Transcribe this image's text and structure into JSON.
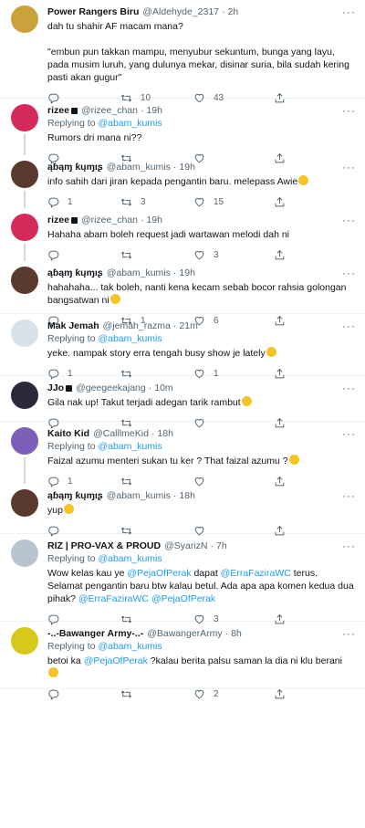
{
  "tweets": [
    {
      "name": "Power Rangers Biru",
      "handle": "@Aldehyde_2317",
      "time": "2h",
      "replying": "",
      "reply_to": "",
      "text": "dah tu shahir AF macam mana?\n\n\"embun pun takkan mampu, menyubur sekuntum, bunga yang layu, pada musim luruh, yang dulunya mekar, disinar suria, bila sudah kering pasti akan gugur\"",
      "replies": "",
      "retweets": "10",
      "likes": "43",
      "avatar_color": "#c9a23a"
    },
    {
      "name": "rizee",
      "handle": "@rizee_chan",
      "time": "19h",
      "replying": "Replying to",
      "reply_to": "@abam_kumis",
      "text": "Rumors dri mana ni??",
      "replies": "",
      "retweets": "",
      "likes": "",
      "avatar_color": "#d62b5a"
    },
    {
      "name": "ąɓąɱ ƙųɱıʂ",
      "handle": "@abam_kumis",
      "time": "19h",
      "replying": "",
      "reply_to": "",
      "text": "info sahih dari jiran kepada pengantin baru. melepass Awie",
      "replies": "1",
      "retweets": "3",
      "likes": "15",
      "avatar_color": "#5a3a2e"
    },
    {
      "name": "rizee",
      "handle": "@rizee_chan",
      "time": "19h",
      "replying": "",
      "reply_to": "",
      "text": "Hahaha abam boleh request jadi wartawan melodi dah ni",
      "replies": "",
      "retweets": "",
      "likes": "3",
      "avatar_color": "#d62b5a"
    },
    {
      "name": "ąɓąɱ ƙųɱıʂ",
      "handle": "@abam_kumis",
      "time": "19h",
      "replying": "",
      "reply_to": "",
      "text": "hahahaha... tak boleh, nanti kena kecam sebab bocor rahsia golongan bangsatwan ni",
      "replies": "",
      "retweets": "1",
      "likes": "6",
      "avatar_color": "#5a3a2e"
    },
    {
      "name": "Mak Jemah",
      "handle": "@jemah_razma",
      "time": "21m",
      "replying": "Replying to",
      "reply_to": "@abam_kumis",
      "text": "yeke. nampak story erra tengah busy show je lately",
      "replies": "1",
      "retweets": "",
      "likes": "1",
      "avatar_color": "#d8e2ea"
    },
    {
      "name": "JJo",
      "handle": "@geegeekajang",
      "time": "10m",
      "replying": "",
      "reply_to": "",
      "text": "Gila nak up! Takut terjadi adegan tarik rambut",
      "replies": "",
      "retweets": "",
      "likes": "",
      "avatar_color": "#2a2a3a"
    },
    {
      "name": "Kaito Kid",
      "handle": "@CalllmeKid",
      "time": "18h",
      "replying": "Replying to",
      "reply_to": "@abam_kumis",
      "text": "Faizal azumu menteri sukan tu ker ? That faizal azumu ?",
      "replies": "1",
      "retweets": "",
      "likes": "",
      "avatar_color": "#7b5fb8"
    },
    {
      "name": "ąɓąɱ ƙųɱıʂ",
      "handle": "@abam_kumis",
      "time": "18h",
      "replying": "",
      "reply_to": "",
      "text": "yup",
      "replies": "",
      "retweets": "",
      "likes": "",
      "avatar_color": "#5a3a2e"
    },
    {
      "name": "RIZ | PRO-VAX & PROUD",
      "handle": "@SyarizN",
      "time": "7h",
      "replying": "Replying to",
      "reply_to": "@abam_kumis",
      "text": "",
      "replies": "",
      "retweets": "",
      "likes": "3",
      "avatar_color": "#b8c4cf"
    },
    {
      "name": "-..-Bawanger Army-..-",
      "handle": "@BawangerArmy",
      "time": "8h",
      "replying": "Replying to",
      "reply_to": "@abam_kumis",
      "text": "",
      "replies": "",
      "retweets": "",
      "likes": "2",
      "avatar_color": "#d8c81a"
    }
  ],
  "riz_text": {
    "a": "Wow kelas kau ye ",
    "b": "@PejaOfPerak",
    "c": " dapat ",
    "d": "@ErraFaziraWC",
    "e": " terus. Selamat pengantin baru btw kalau betul. Ada apa apa komen kedua dua pihak? ",
    "f": "@ErraFaziraWC",
    "g": " ",
    "h": "@PejaOfPerak"
  },
  "bawang_text": {
    "a": "betoi ka ",
    "b": "@PejaOfPerak",
    "c": " ?kalau berita palsu saman la dia ni klu berani "
  },
  "ui": {
    "dot": "·",
    "more": "···"
  }
}
